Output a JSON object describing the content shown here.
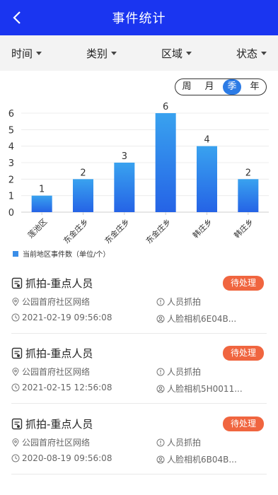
{
  "header": {
    "title": "事件统计"
  },
  "filters": [
    {
      "label": "时间"
    },
    {
      "label": "类别"
    },
    {
      "label": "区域"
    },
    {
      "label": "状态"
    }
  ],
  "period": {
    "options": [
      "周",
      "月",
      "季",
      "年"
    ],
    "selected": "季"
  },
  "chart_data": {
    "type": "bar",
    "categories": [
      "莲池区",
      "东金庄乡",
      "东金庄乡",
      "东金庄乡",
      "韩庄乡",
      "韩庄乡"
    ],
    "values": [
      1,
      2,
      3,
      6,
      4,
      2
    ],
    "yticks": [
      "0",
      "1",
      "2",
      "3",
      "4",
      "5",
      "6"
    ],
    "ylim": [
      0,
      6
    ],
    "legend": "当前地区事件数（单位/个）",
    "bar_color": "#2f86e8"
  },
  "events": [
    {
      "title": "抓拍-重点人员",
      "status": "待处理",
      "location": "公园首府社区网络",
      "type": "人员抓拍",
      "time": "2021-02-19  09:56:08",
      "device": "人脸相机6E04B..."
    },
    {
      "title": "抓拍-重点人员",
      "status": "待处理",
      "location": "公园首府社区网络",
      "type": "人员抓拍",
      "time": "2021-02-15  12:56:08",
      "device": "人脸相机5H0011..."
    },
    {
      "title": "抓拍-重点人员",
      "status": "待处理",
      "location": "公园首府社区网络",
      "type": "人员抓拍",
      "time": "2020-08-19  09:56:08",
      "device": "人脸相机6B04B..."
    }
  ],
  "colors": {
    "header": "#1a35f0",
    "badge": "#f0653f",
    "accent": "#2c7be5"
  }
}
